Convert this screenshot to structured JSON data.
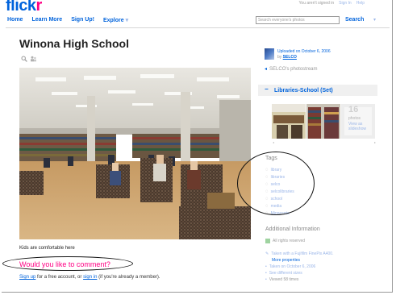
{
  "header": {
    "logo_main": "flick",
    "logo_accent": "r",
    "nav": [
      {
        "label": "Home"
      },
      {
        "label": "Learn More"
      },
      {
        "label": "Sign Up!"
      },
      {
        "label": "Explore"
      }
    ],
    "nav_caret": "▾",
    "top_right": {
      "text": "You aren't signed in",
      "sign_in": "Sign In",
      "help": "Help"
    },
    "search": {
      "placeholder": "Search everyone's photos",
      "button": "Search",
      "caret": "▾"
    }
  },
  "photo_page": {
    "title": "Winona High School",
    "caption": "Kids are comfortable here",
    "comment_prompt": "Would you like to comment?",
    "signup": {
      "signup_link": "Sign up",
      "mid_text": " for a free account, or ",
      "signin_link": "sign in",
      "end_text": " (if you're already a member)."
    }
  },
  "sidebar": {
    "uploaded_on": "Uploaded on October 6, 2006",
    "by_text": "by",
    "by_user": "SELCO",
    "photostream": "SELCO's photostream",
    "set": {
      "collapse": "−",
      "title": "Libraries-School (Set)",
      "count": "16",
      "count_label": "photos",
      "view_link": "View as slideshow"
    },
    "tags": {
      "heading": "Tags",
      "items": [
        "library",
        "libraries",
        "selco",
        "selcolibraries",
        "school",
        "media",
        "Minnesota"
      ]
    },
    "additional": {
      "heading": "Additional Information",
      "rights": "All rights reserved",
      "items": [
        {
          "text": "Taken with a Fujifilm FinePix A400."
        },
        {
          "text": "More properties",
          "sub": true
        },
        {
          "text": "Taken on October 6, 2006"
        },
        {
          "text": "See different sizes"
        },
        {
          "text": "Viewed 58 times"
        }
      ]
    }
  },
  "colors": {
    "flickr_blue": "#0063dc",
    "flickr_pink": "#ff0084",
    "muted_link": "#9bb6e8"
  },
  "icons": {
    "zoom": "magnifier-icon",
    "people": "people-icon",
    "tag": "tag-icon",
    "license": "creative-commons-icon"
  }
}
